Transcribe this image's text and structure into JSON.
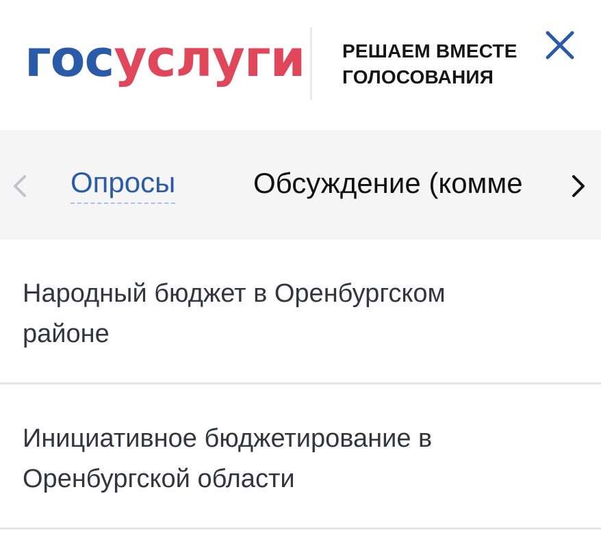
{
  "header": {
    "logo_part1": "гос",
    "logo_part2": "услуги",
    "tagline_line1": "РЕШАЕМ ВМЕСТЕ",
    "tagline_line2": "ГОЛОСОВАНИЯ",
    "close_icon": "close-icon"
  },
  "tabs": {
    "items": [
      {
        "label": "Опросы",
        "active": true
      },
      {
        "label": "Обсуждение (комме",
        "active": false
      }
    ],
    "prev_icon": "chevron-left-icon",
    "next_icon": "chevron-right-icon"
  },
  "list": {
    "items": [
      {
        "title": "Народный бюджет в Оренбургском районе"
      },
      {
        "title": "Инициативное бюджетирование в Оренбургской области"
      }
    ]
  },
  "colors": {
    "brand_blue": "#2b5ba8",
    "brand_red": "#e0475a",
    "tab_bar_bg": "#f5f5f5",
    "text_dark": "#34353f"
  }
}
